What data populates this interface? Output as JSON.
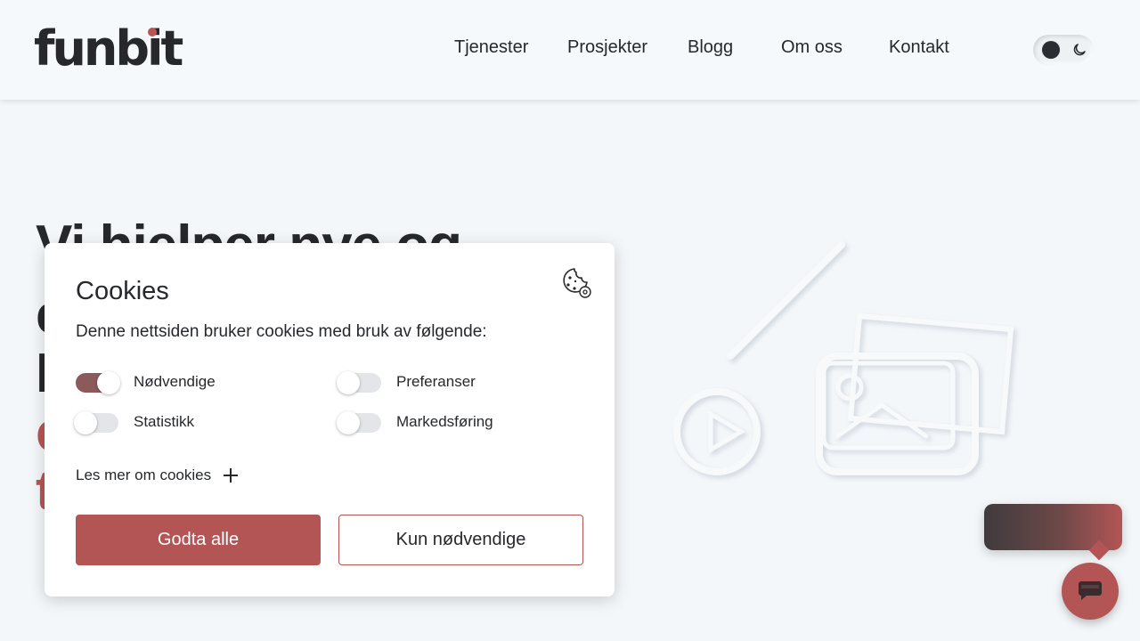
{
  "header": {
    "logo": "funbit",
    "nav": [
      {
        "label": "Tjenester"
      },
      {
        "label": "Prosjekter"
      },
      {
        "label": "Blogg"
      },
      {
        "label": "Om oss"
      },
      {
        "label": "Kontakt"
      }
    ],
    "theme_toggle": {
      "icon": "moon-icon",
      "state": "light"
    }
  },
  "hero": {
    "line1": "Vi hjelper nye og",
    "line2": "e",
    "line3": "I",
    "line4": "c",
    "line5": "t"
  },
  "cookie_dialog": {
    "title": "Cookies",
    "description": "Denne nettsiden bruker cookies med bruk av følgende:",
    "icon": "cookie-settings-icon",
    "options": [
      {
        "label": "Nødvendige",
        "enabled": true
      },
      {
        "label": "Preferanser",
        "enabled": false
      },
      {
        "label": "Statistikk",
        "enabled": false
      },
      {
        "label": "Markedsføring",
        "enabled": false
      }
    ],
    "read_more": "Les mer om cookies",
    "accept_all": "Godta alle",
    "only_necessary": "Kun nødvendige"
  },
  "colors": {
    "accent": "#b45555",
    "toggle_on": "#8b5a5a",
    "background": "#f4f7fa",
    "text": "#26282c"
  },
  "chat": {
    "icon": "chat-icon"
  }
}
